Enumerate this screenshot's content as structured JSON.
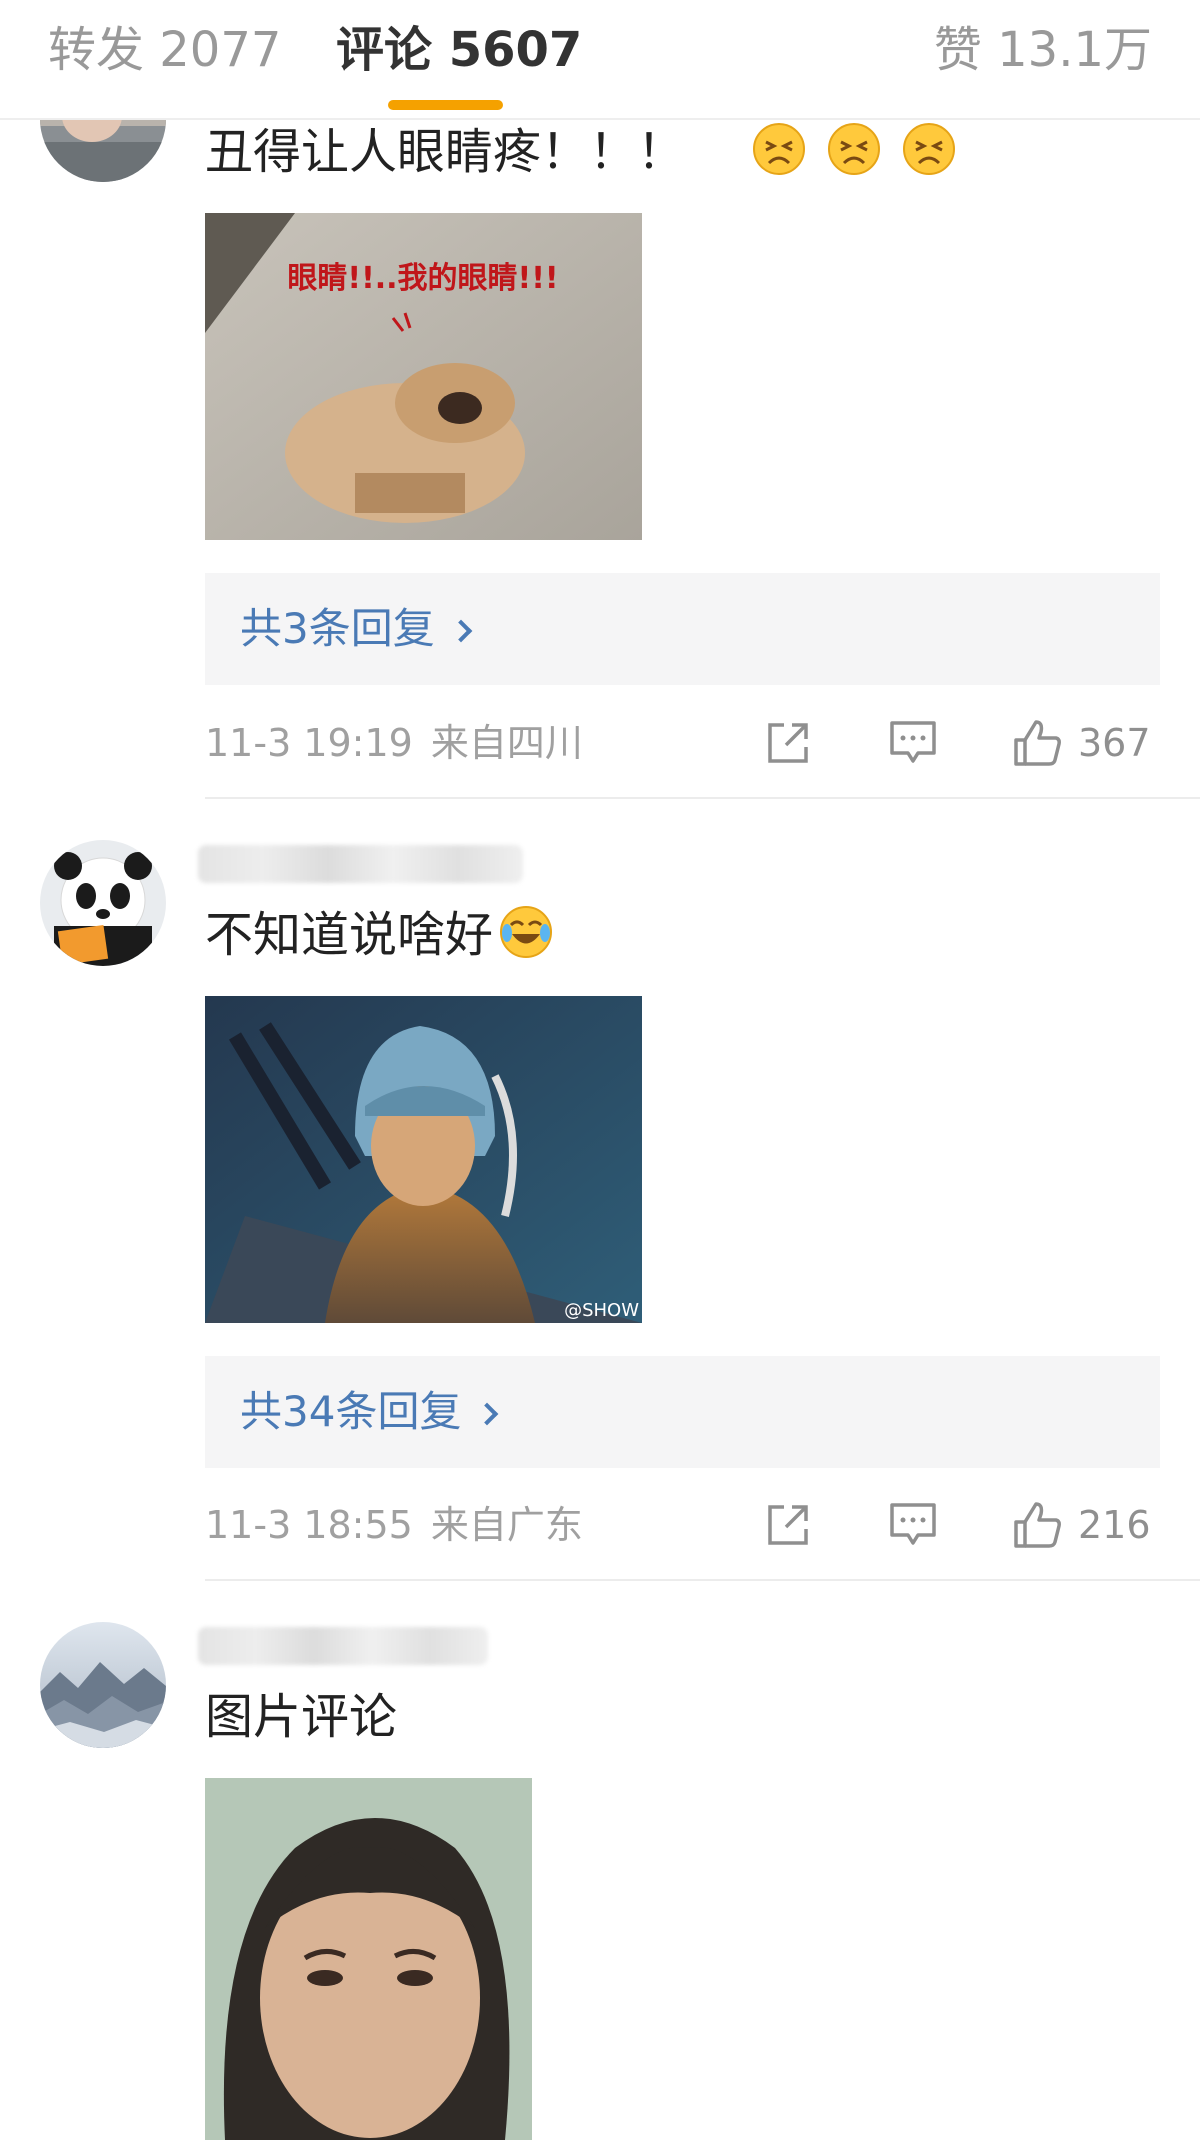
{
  "tabs": {
    "reposts": "转发 2077",
    "comments": "评论 5607",
    "likes": "赞 13.1万",
    "active": "comments",
    "accent_color": "#f5a100"
  },
  "comments": [
    {
      "text": "丑得让人眼睛疼！！！",
      "emoji": [
        "frown-emoji",
        "frown-emoji",
        "frown-emoji"
      ],
      "image_caption": "眼睛!!..我的眼睛!!!",
      "reply_label": "共3条回复",
      "time": "11-3 19:19",
      "location": "来自四川",
      "likes": "367"
    },
    {
      "text": "不知道说啥好",
      "emoji": [
        "laugh-cry-emoji"
      ],
      "image_watermark": "@SHOW",
      "reply_label": "共34条回复",
      "time": "11-3 18:55",
      "location": "来自广东",
      "likes": "216"
    },
    {
      "text": "图片评论"
    }
  ],
  "colors": {
    "link": "#4a7ab5",
    "meta": "#a0a0a0",
    "reply_bg": "#f5f5f6"
  }
}
